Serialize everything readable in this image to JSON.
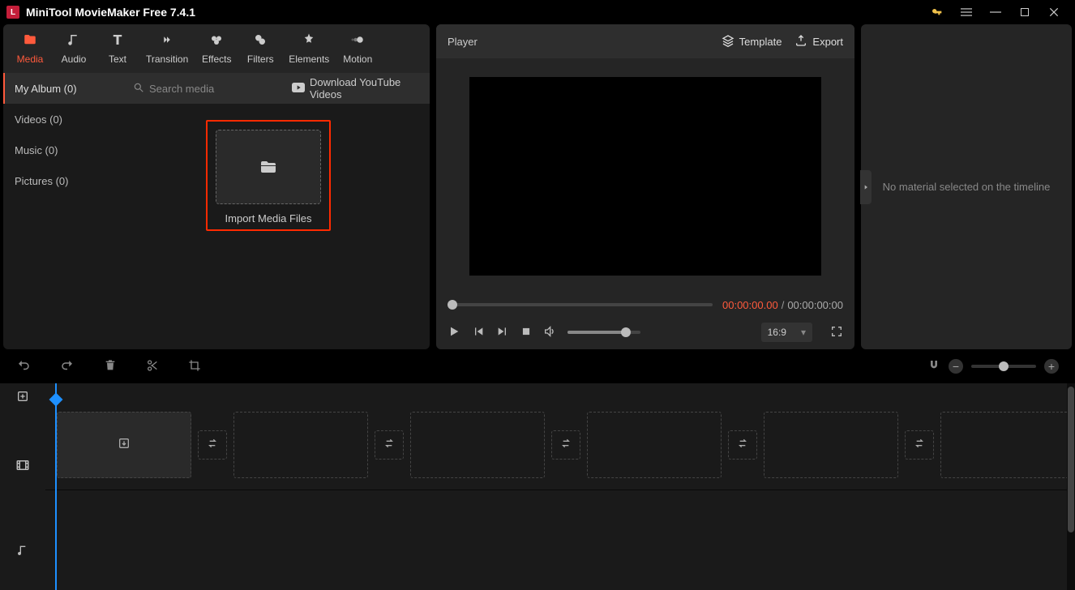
{
  "titlebar": {
    "app_title": "MiniTool MovieMaker Free 7.4.1"
  },
  "tools": {
    "media": "Media",
    "audio": "Audio",
    "text": "Text",
    "transition": "Transition",
    "effects": "Effects",
    "filters": "Filters",
    "elements": "Elements",
    "motion": "Motion"
  },
  "sidebar": {
    "my_album": "My Album (0)",
    "videos": "Videos (0)",
    "music": "Music (0)",
    "pictures": "Pictures (0)"
  },
  "media": {
    "search_placeholder": "Search media",
    "download_youtube": "Download YouTube Videos",
    "import_label": "Import Media Files"
  },
  "player": {
    "title": "Player",
    "template": "Template",
    "export": "Export",
    "time_current": "00:00:00.00",
    "time_total": "00:00:00:00",
    "time_divider": "/",
    "aspect": "16:9"
  },
  "right_panel": {
    "message": "No material selected on the timeline"
  }
}
